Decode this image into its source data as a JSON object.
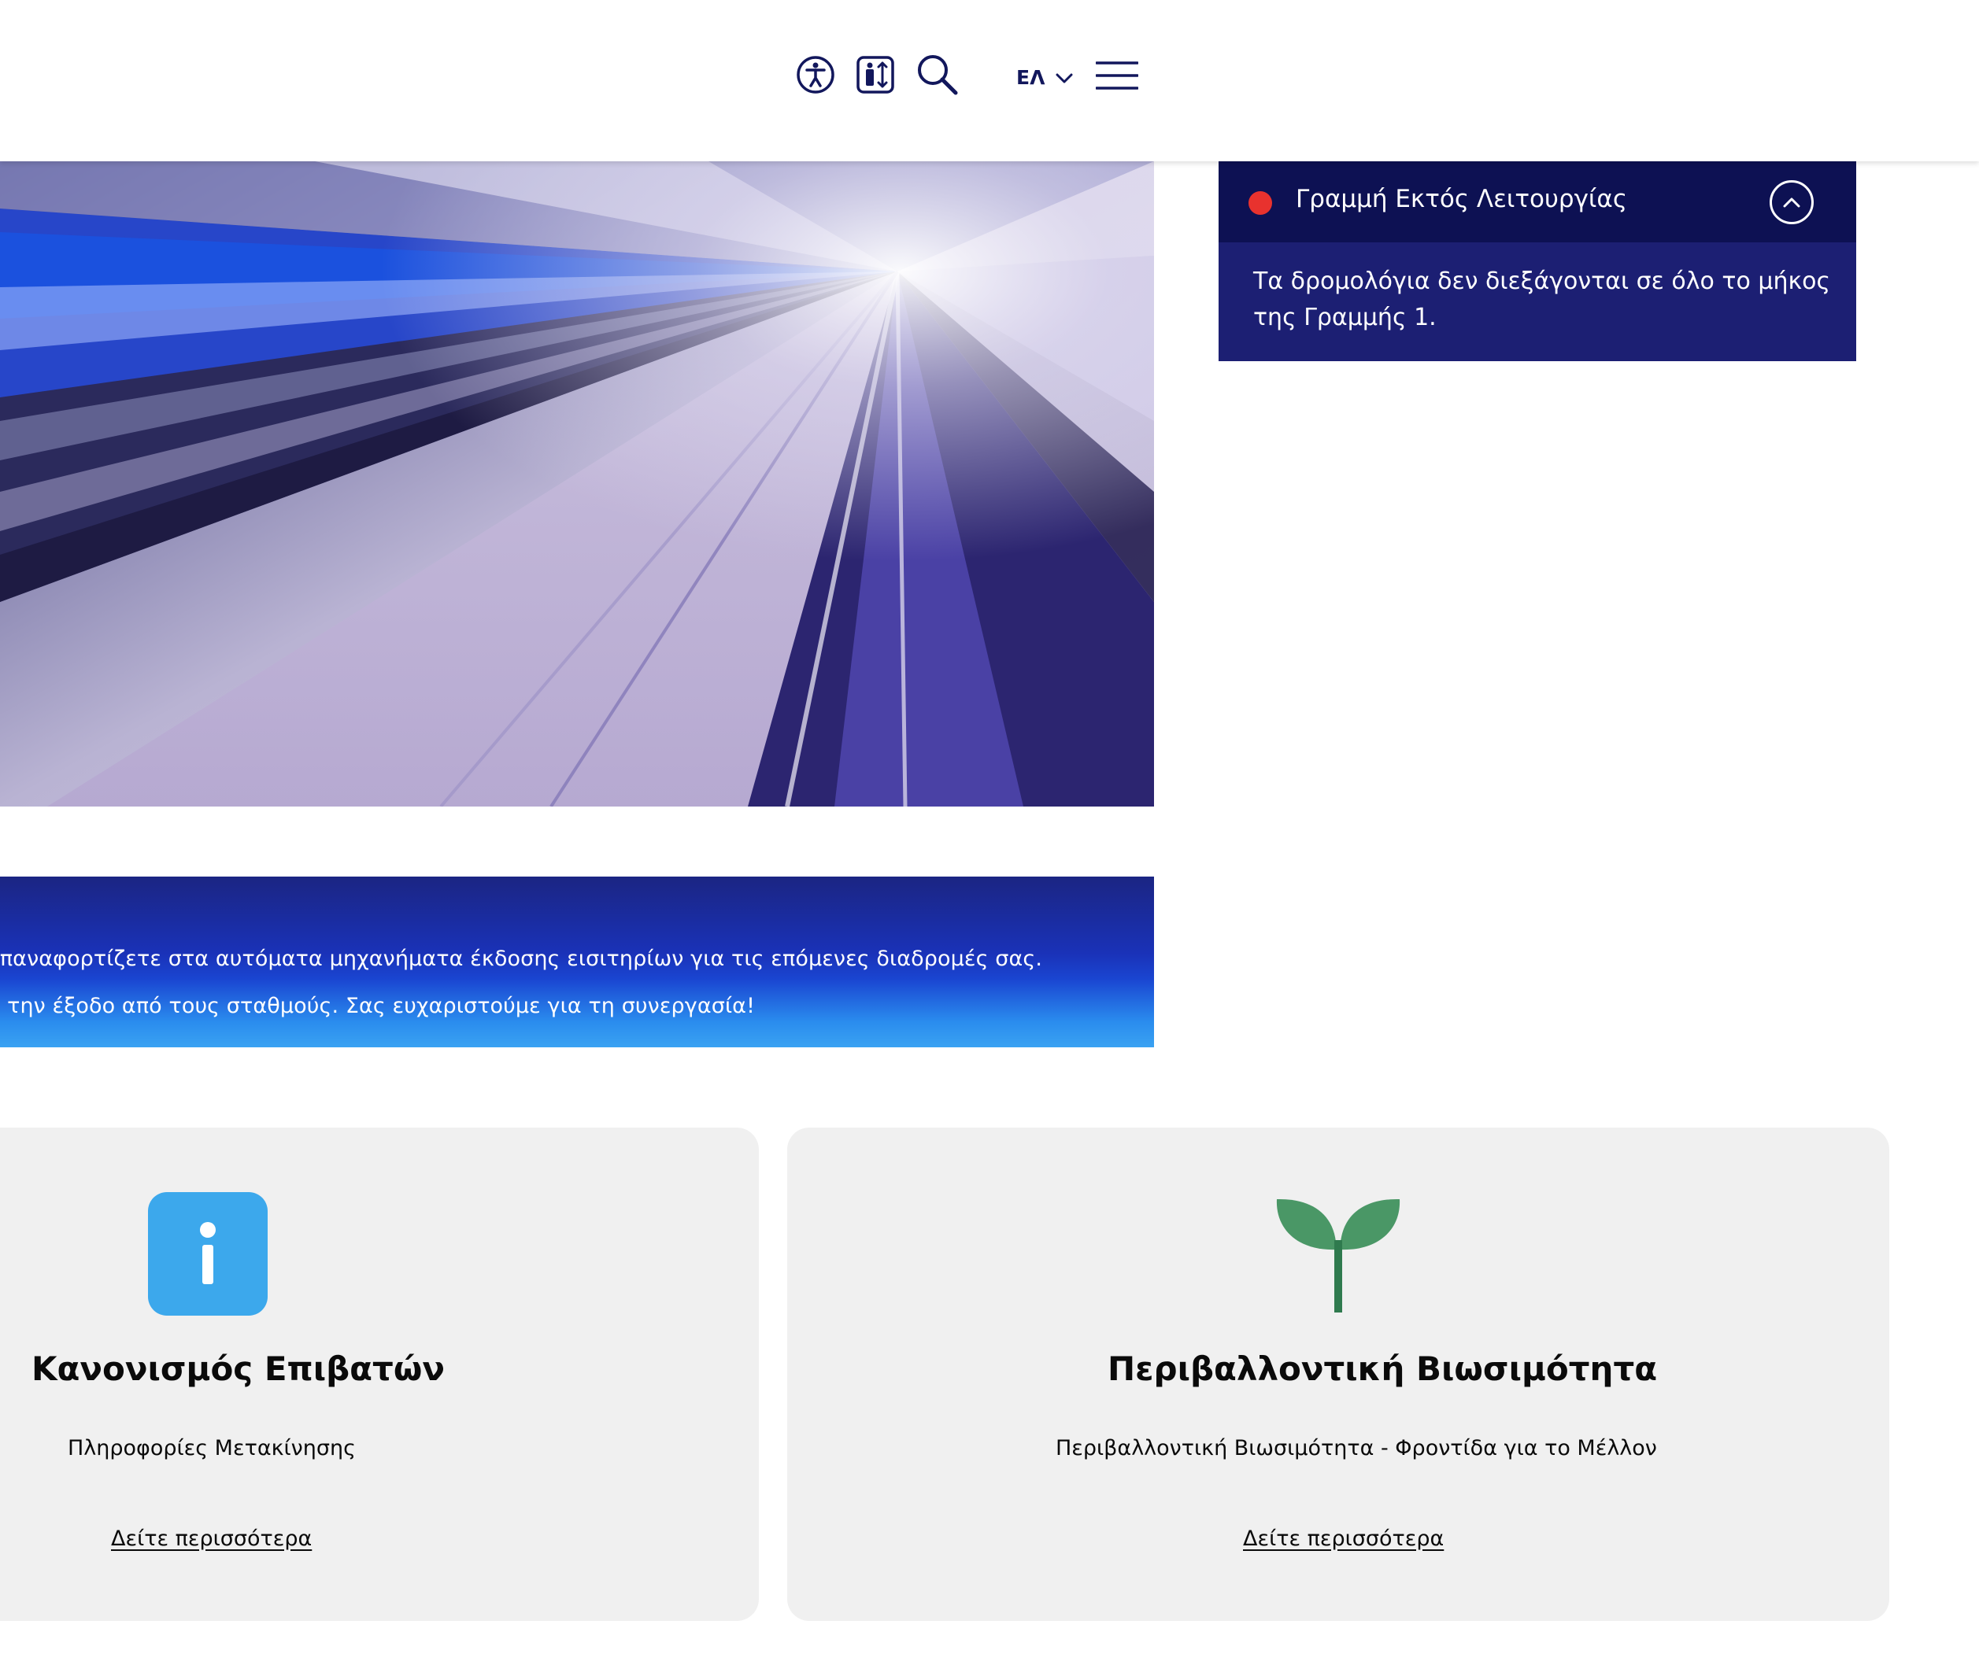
{
  "header": {
    "accessibility_icon": "accessibility-icon",
    "elevator_icon": "elevator-icon",
    "search_icon": "search-icon",
    "language": "ΕΛ",
    "language_chevron_icon": "chevron-down-icon",
    "menu_icon": "hamburger-menu-icon"
  },
  "status": {
    "title": "Γραμμή Εκτός Λειτουργίας",
    "indicator_color": "#e8322e",
    "toggle_icon": "chevron-up-icon",
    "message": "Τα δρομολόγια δεν διεξάγονται σε όλο το μήκος της Γραμμής 1."
  },
  "notice": {
    "line1": "α τα επαναφορτίζετε στα αυτόματα μηχανήματα έκδοσης εισιτηρίων για τις επόμενες διαδρομές σας.",
    "line2": "ατά την έξοδο από τους σταθμούς. Σας ευχαριστούμε για τη συνεργασία!"
  },
  "cards": [
    {
      "icon": "info-icon",
      "icon_glyph": "i",
      "title": "Κανονισμός Επιβατών",
      "subtitle": "Πληροφορίες Μετακίνησης",
      "link": "Δείτε περισσότερα"
    },
    {
      "icon": "sprout-icon",
      "title": "Περιβαλλοντική Βιωσιμότητα",
      "subtitle": "Περιβαλλοντική Βιωσιμότητα - Φροντίδα για το Μέλλον",
      "link": "Δείτε περισσότερα"
    }
  ],
  "colors": {
    "brand_navy": "#12175c",
    "status_header": "#0d1153",
    "status_body": "#1c1f73",
    "info_blue": "#3ca8ec",
    "sprout_green": "#4a9766",
    "card_bg": "#f0f0f0"
  }
}
